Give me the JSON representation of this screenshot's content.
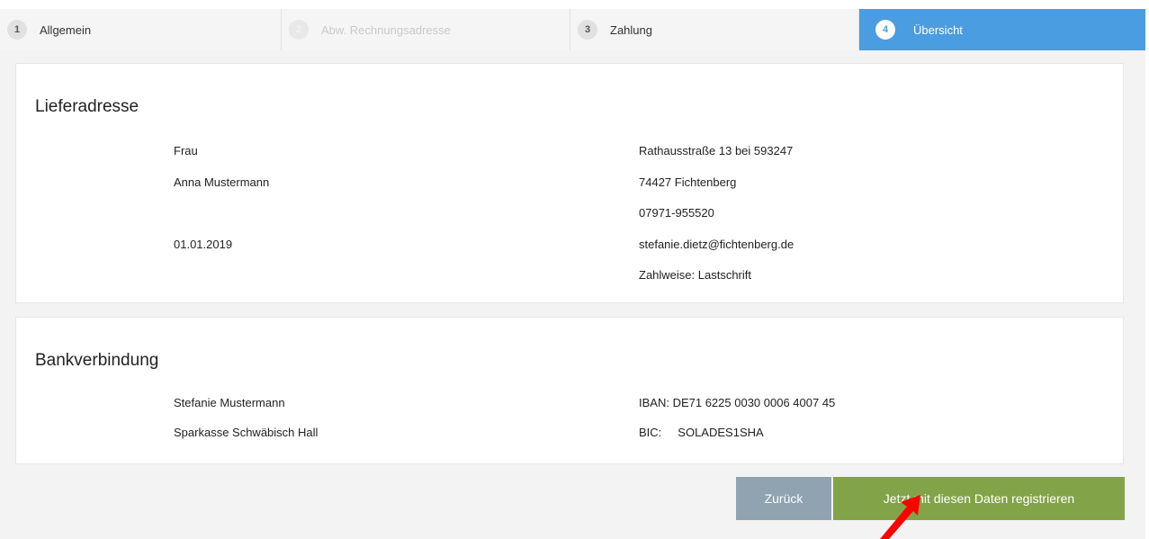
{
  "stepper": {
    "steps": [
      {
        "num": "1",
        "label": "Allgemein"
      },
      {
        "num": "2",
        "label": "Abw. Rechnungsadresse"
      },
      {
        "num": "3",
        "label": "Zahlung"
      },
      {
        "num": "4",
        "label": "Übersicht"
      }
    ],
    "active_step": "4",
    "disabled_step": "2"
  },
  "address": {
    "title": "Lieferadresse",
    "salutation": "Frau",
    "name": "Anna Mustermann",
    "birthdate": "01.01.2019",
    "street": "Rathausstraße 13 bei 593247",
    "city": "74427 Fichtenberg",
    "phone": "07971-955520",
    "email": "stefanie.dietz@fichtenberg.de",
    "payment": "Zahlweise: Lastschrift"
  },
  "bank": {
    "title": "Bankverbindung",
    "account_holder": "Stefanie Mustermann",
    "bank_name": "Sparkasse Schwäbisch Hall",
    "iban": "IBAN: DE71 6225 0030 0006 4007 45",
    "bic_label": "BIC:",
    "bic_value": "SOLADES1SHA"
  },
  "actions": {
    "back_label": "Zurück",
    "register_label": "Jetzt mit diesen Daten registrieren"
  },
  "colors": {
    "active_step": "#4a9de0",
    "back_button": "#8fa3b0",
    "register_button": "#83a349",
    "annotation_arrow": "#ff0000"
  },
  "annotation": {
    "icon": "red-arrow-pointer-icon"
  }
}
